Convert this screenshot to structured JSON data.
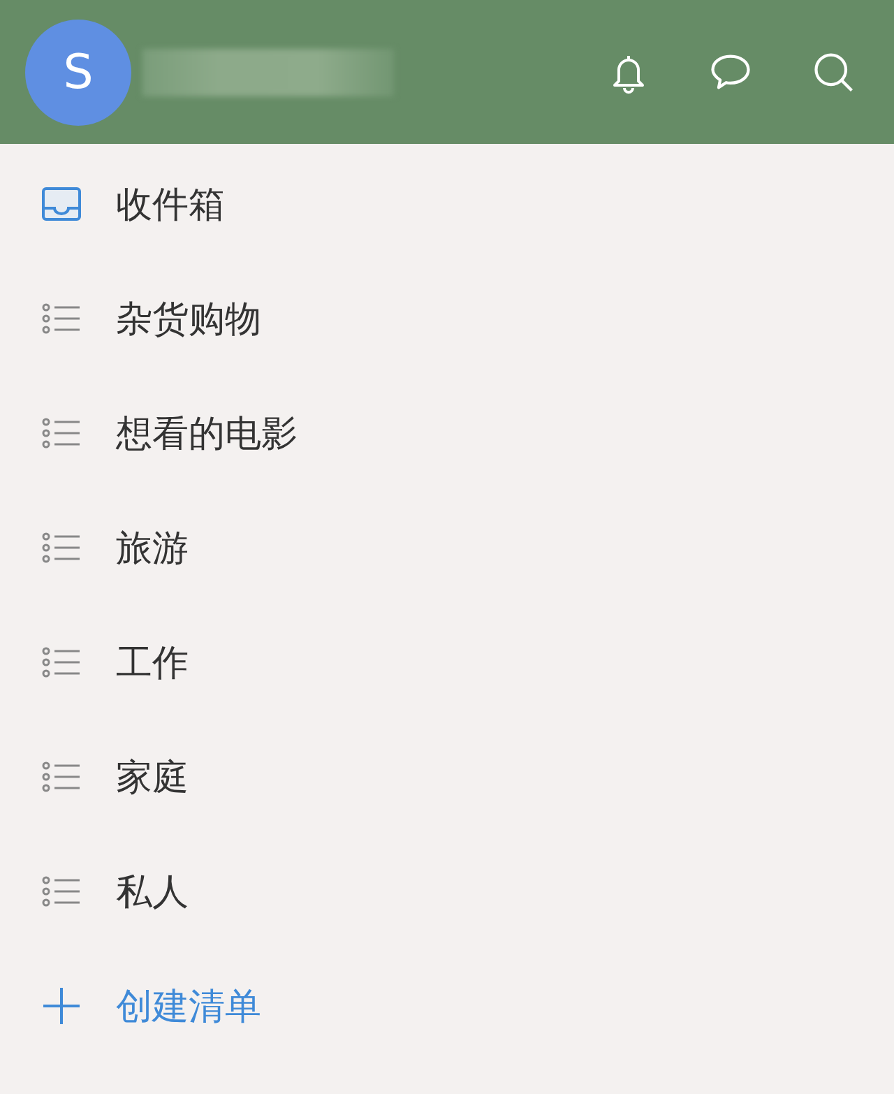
{
  "header": {
    "avatar": {
      "initial": "S"
    }
  },
  "lists": [
    {
      "kind": "inbox",
      "label": "收件箱"
    },
    {
      "kind": "list",
      "label": "杂货购物"
    },
    {
      "kind": "list",
      "label": "想看的电影"
    },
    {
      "kind": "list",
      "label": "旅游"
    },
    {
      "kind": "list",
      "label": "工作"
    },
    {
      "kind": "list",
      "label": "家庭"
    },
    {
      "kind": "list",
      "label": "私人"
    }
  ],
  "create_list": {
    "label": "创建清单"
  }
}
